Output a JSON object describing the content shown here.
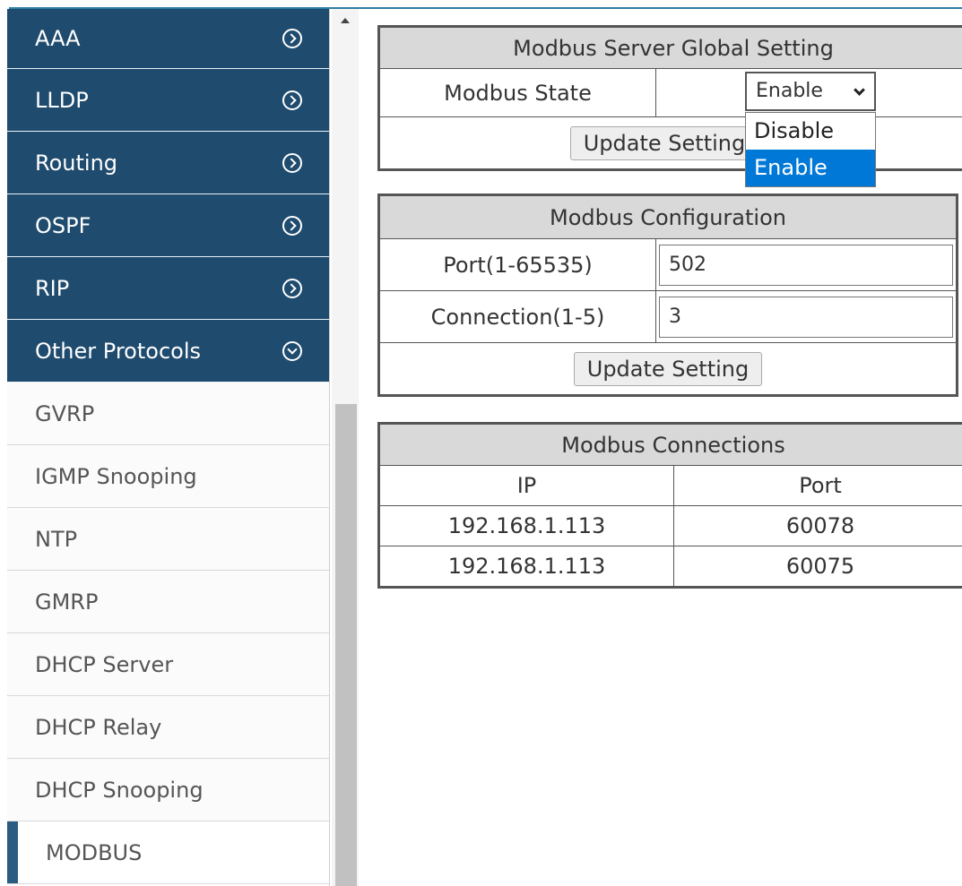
{
  "sidebar": {
    "items": [
      {
        "label": "AAA"
      },
      {
        "label": "LLDP"
      },
      {
        "label": "Routing"
      },
      {
        "label": "OSPF"
      },
      {
        "label": "RIP"
      },
      {
        "label": "Other Protocols"
      },
      {
        "label": "GVRP"
      },
      {
        "label": "IGMP Snooping"
      },
      {
        "label": "NTP"
      },
      {
        "label": "GMRP"
      },
      {
        "label": "DHCP Server"
      },
      {
        "label": "DHCP Relay"
      },
      {
        "label": "DHCP Snooping"
      },
      {
        "label": "MODBUS"
      }
    ]
  },
  "global": {
    "title": "Modbus Server Global Setting",
    "state_label": "Modbus State",
    "state_value": "Enable",
    "button": "Update Setting"
  },
  "dropdown": {
    "options": [
      {
        "label": "Disable"
      },
      {
        "label": "Enable"
      }
    ]
  },
  "config": {
    "title": "Modbus Configuration",
    "port_label": "Port(1-65535)",
    "port_value": "502",
    "conn_label": "Connection(1-5)",
    "conn_value": "3",
    "button": "Update Setting"
  },
  "connections": {
    "title": "Modbus Connections",
    "headers": [
      "IP",
      "Port"
    ],
    "rows": [
      [
        "192.168.1.113",
        "60078"
      ],
      [
        "192.168.1.113",
        "60075"
      ]
    ]
  }
}
